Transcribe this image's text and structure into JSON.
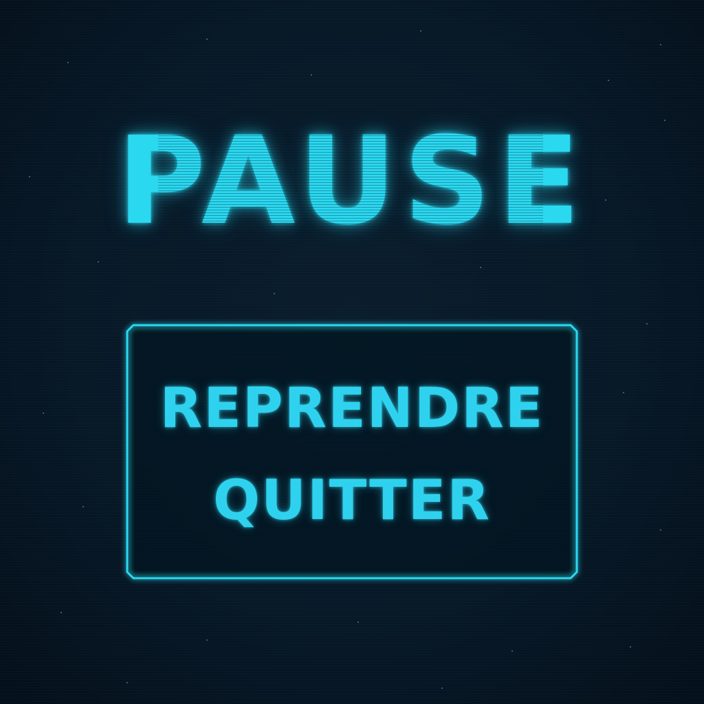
{
  "pause_menu": {
    "title": "PAUSE",
    "items": [
      {
        "label": "REPRENDRE"
      },
      {
        "label": "QUITTER"
      }
    ]
  },
  "colors": {
    "background": "#071827",
    "accent": "#2ad8f0"
  }
}
